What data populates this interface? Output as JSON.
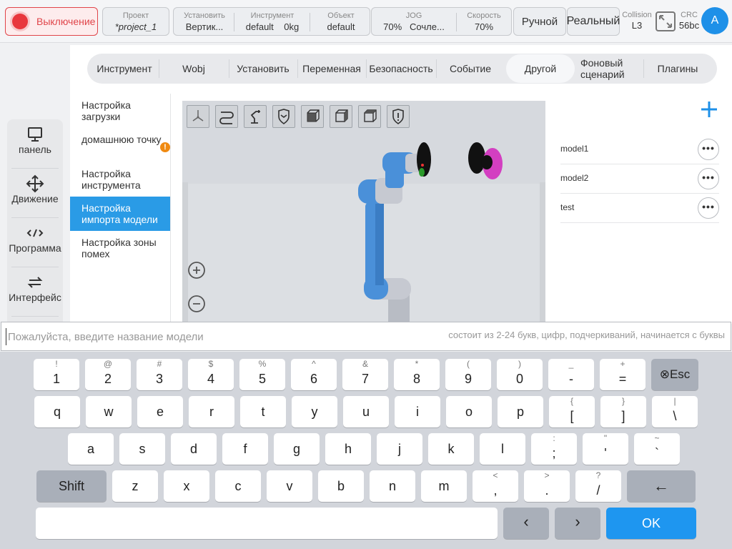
{
  "topbar": {
    "power_label": "Выключение",
    "project": {
      "label": "Проект",
      "value": "*project_1"
    },
    "install": {
      "label": "Установить",
      "value": "Вертик..."
    },
    "tool": {
      "label": "Инструмент",
      "value": "default",
      "weight": "0kg"
    },
    "object": {
      "label": "Объект",
      "value": "default"
    },
    "jog": {
      "label": "JOG",
      "value": "70%",
      "mode": "Сочле..."
    },
    "speed": {
      "label": "Скорость",
      "value": "70%"
    },
    "manual_label": "Ручной",
    "real_label": "Реальный",
    "collision": {
      "label": "Collision",
      "value": "L3"
    },
    "crc": {
      "label": "CRC",
      "value": "56bc"
    },
    "avatar_letter": "A"
  },
  "sidebar": {
    "items": [
      {
        "label": "панель",
        "icon": "monitor-icon"
      },
      {
        "label": "Движение",
        "icon": "move-icon"
      },
      {
        "label": "Программа",
        "icon": "code-icon"
      },
      {
        "label": "Интерфейс",
        "icon": "swap-icon"
      }
    ]
  },
  "tabs": [
    {
      "label": "Инструмент"
    },
    {
      "label": "Wobj"
    },
    {
      "label": "Установить"
    },
    {
      "label": "Переменная"
    },
    {
      "label": "Безопасность"
    },
    {
      "label": "Событие"
    },
    {
      "label": "Другой"
    },
    {
      "label": "Фоновый сценарий"
    },
    {
      "label": "Плагины"
    }
  ],
  "submenu": [
    {
      "label": "Настройка загрузки"
    },
    {
      "label": "домашнюю точку",
      "badge": "!"
    },
    {
      "label": "Настройка инструмента"
    },
    {
      "label": "Настройка импорта модели"
    },
    {
      "label": "Настройка зоны помех"
    }
  ],
  "viewport_tools": [
    "axes-icon",
    "path-icon",
    "robot-icon",
    "shield-icon",
    "cube-front-icon",
    "cube-side-icon",
    "cube-iso-icon",
    "shield-alert-icon"
  ],
  "models": [
    "model1",
    "model2",
    "test"
  ],
  "more_label": "•••",
  "input": {
    "value": "",
    "placeholder": "Пожалуйста, введите название модели",
    "hint": "состоит из 2-24 букв, цифр, подчеркиваний, начинается с буквы"
  },
  "keyboard": {
    "row1": [
      [
        "!",
        "1"
      ],
      [
        "@",
        "2"
      ],
      [
        "#",
        "3"
      ],
      [
        "$",
        "4"
      ],
      [
        "%",
        "5"
      ],
      [
        "^",
        "6"
      ],
      [
        "&",
        "7"
      ],
      [
        "*",
        "8"
      ],
      [
        "(",
        "9"
      ],
      [
        ")",
        "0"
      ],
      [
        "_",
        "-"
      ],
      [
        "+",
        "="
      ]
    ],
    "esc_label": "Esc",
    "row2": [
      [
        "",
        "q"
      ],
      [
        "",
        "w"
      ],
      [
        "",
        "e"
      ],
      [
        "",
        "r"
      ],
      [
        "",
        "t"
      ],
      [
        "",
        "y"
      ],
      [
        "",
        "u"
      ],
      [
        "",
        "i"
      ],
      [
        "",
        "o"
      ],
      [
        "",
        "p"
      ],
      [
        "{",
        "["
      ],
      [
        "}",
        "]"
      ],
      [
        "|",
        "\\"
      ]
    ],
    "row3": [
      [
        "",
        "a"
      ],
      [
        "",
        "s"
      ],
      [
        "",
        "d"
      ],
      [
        "",
        "f"
      ],
      [
        "",
        "g"
      ],
      [
        "",
        "h"
      ],
      [
        "",
        "j"
      ],
      [
        "",
        "k"
      ],
      [
        "",
        "l"
      ],
      [
        ":",
        ";"
      ],
      [
        "\"",
        "'"
      ],
      [
        "~",
        "`"
      ]
    ],
    "shift_label": "Shift",
    "row4": [
      [
        "",
        "z"
      ],
      [
        "",
        "x"
      ],
      [
        "",
        "c"
      ],
      [
        "",
        "v"
      ],
      [
        "",
        "b"
      ],
      [
        "",
        "n"
      ],
      [
        "",
        "m"
      ],
      [
        "<",
        ","
      ],
      [
        ">",
        "."
      ],
      [
        "?",
        "/"
      ]
    ],
    "backspace_label": "←",
    "left_label": "‹",
    "right_label": "›",
    "ok_label": "OK"
  },
  "colors": {
    "accent": "#1e96f0",
    "active_menu": "#2a9be6",
    "power": "#e8373d",
    "robot": "#4a90d9",
    "warning": "#f08a12"
  }
}
